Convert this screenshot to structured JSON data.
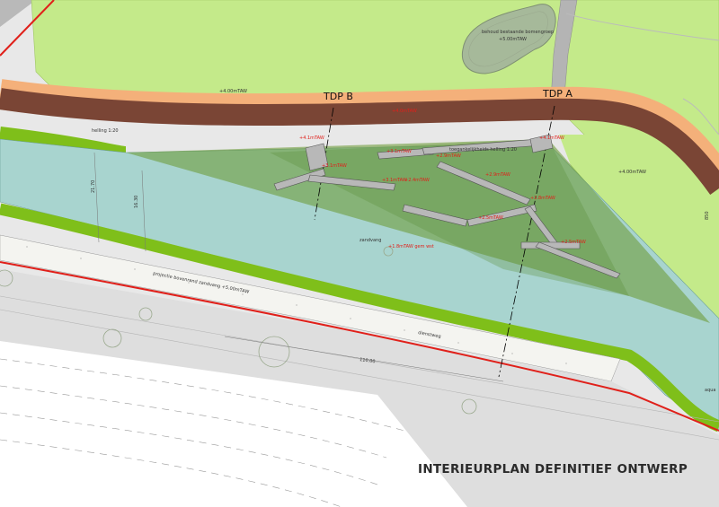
{
  "title": "INTERIEURPLAN DEFINITIEF ONTWERP",
  "sections": {
    "a": "TDP A",
    "b": "TDP B"
  },
  "labels": {
    "tree_group_line1": "behoud bestaande bomengroep",
    "tree_group_line2": "+5.00mTAW",
    "lawn_left": "+4.00mTAW",
    "lawn_right": "+4.00mTAW",
    "path_level": "+4.0mTAW",
    "slope": "helling 1:20",
    "sandtrap": "zandvang",
    "sandtrap_level": "+1.8mTAW gem wst",
    "projection": "projectie bovenrand zandvang +5.00mTAW",
    "service_road": "dienstweg",
    "dim_110": "110.00",
    "dim_2170": "21.70",
    "dim_1630": "16.30",
    "edge_right": "850",
    "edge_water": "aqua",
    "accessibility": "toegankelijkheids helling 1:20"
  },
  "levels": [
    "+4.1mTAW",
    "+3.1mTAW",
    "+3.1mTAW",
    "+3.1mTAW",
    "+2.4mTAW",
    "+2.9mTAW",
    "+2.9mTAW",
    "+2.8mTAW",
    "+2.5mTAW",
    "+2.5mTAW",
    "+4.1mTAW"
  ],
  "colors": {
    "lawn": "#c4ea8a",
    "berm": "#7fbf1a",
    "water": "#a8d4cf",
    "path": "#7a4535",
    "path_edge": "#f4b07a",
    "plaza": "#6f9d3c",
    "boundary": "#e0201a",
    "paving": "#d8d8d8"
  }
}
